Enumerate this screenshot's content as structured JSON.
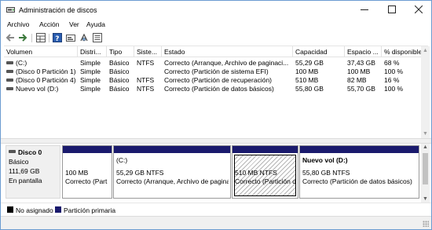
{
  "window": {
    "title": "Administración de discos",
    "icon": "disk-management-icon",
    "controls": {
      "minimize": "minimize-icon",
      "maximize": "maximize-icon",
      "close": "close-icon"
    }
  },
  "menu": [
    "Archivo",
    "Acción",
    "Ver",
    "Ayuda"
  ],
  "toolbar": [
    "back-arrow-icon",
    "forward-arrow-icon",
    "grid-view-icon",
    "help-icon",
    "properties-icon",
    "rescan-icon",
    "list-view-icon"
  ],
  "volumes": {
    "columns": [
      "Volumen",
      "Distri...",
      "Tipo",
      "Siste...",
      "Estado",
      "Capacidad",
      "Espacio ...",
      "% disponible"
    ],
    "rows": [
      [
        "(C:)",
        "Simple",
        "Básico",
        "NTFS",
        "Correcto (Arranque, Archivo de paginaci...",
        "55,29 GB",
        "37,43 GB",
        "68 %"
      ],
      [
        "(Disco 0 Partición 1)",
        "Simple",
        "Básico",
        "",
        "Correcto (Partición de sistema EFI)",
        "100 MB",
        "100 MB",
        "100 %"
      ],
      [
        "(Disco 0 Partición 4)",
        "Simple",
        "Básico",
        "NTFS",
        "Correcto (Partición de recuperación)",
        "510 MB",
        "82 MB",
        "16 %"
      ],
      [
        "Nuevo vol (D:)",
        "Simple",
        "Básico",
        "NTFS",
        "Correcto (Partición de datos básicos)",
        "55,80 GB",
        "55,70 GB",
        "100 %"
      ]
    ]
  },
  "disk": {
    "name": "Disco 0",
    "type": "Básico",
    "size": "111,69 GB",
    "status": "En pantalla",
    "partitions": [
      {
        "title": "",
        "size": "100 MB",
        "status": "Correcto (Part"
      },
      {
        "title": "(C:)",
        "size": "55,29 GB NTFS",
        "status": "Correcto (Arranque, Archivo de pagina"
      },
      {
        "title": "",
        "size": "510 MB NTFS",
        "status": "Correcto (Partición d"
      },
      {
        "title": "Nuevo vol  (D:)",
        "size": "55,80 GB NTFS",
        "status": "Correcto (Partición de datos básicos)"
      }
    ]
  },
  "legend": [
    {
      "label": "No asignado",
      "color": "#000000"
    },
    {
      "label": "Partición primaria",
      "color": "#1a1a6d"
    }
  ]
}
